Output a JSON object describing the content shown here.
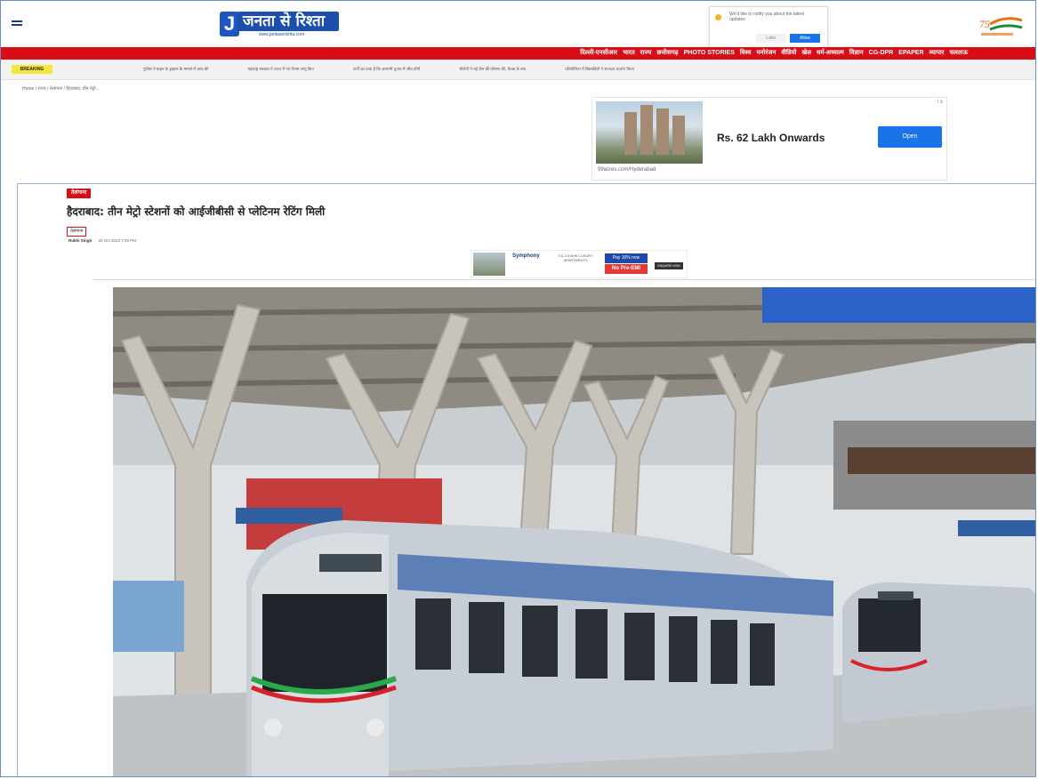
{
  "header": {
    "logo_letter": "J",
    "logo_name": "जनता से रिश्ता",
    "logo_url": "www.jantaserishta.com",
    "badge_text": "75"
  },
  "notification": {
    "message": "We'd like to notify you about the latest updates",
    "sub": "You can unsubscribe from notifications anytime",
    "later": "Later",
    "allow": "Allow"
  },
  "nav": {
    "items": [
      "दिल्ली-एनसीआर",
      "भारत",
      "राज्य",
      "छत्तीसगढ़",
      "PHOTO STORIES",
      "विश्व",
      "मनोरंजन",
      "वीडियो",
      "खेल",
      "धर्म-अध्यात्म",
      "विज्ञान",
      "CG-DPR",
      "EPAPER",
      "व्यापार",
      "चलताऊ"
    ]
  },
  "breaking": {
    "label": "BREAKING",
    "ticker": [
      "पुलिस ने वाहन के ड्राइवर के मामले में जांच की",
      "महाराष्ट्र सरकार ने राज्य में नए नियम लागू किए",
      "पार्टी का दावा है कि आगामी चुनाव में जीत होगी",
      "बीजेपी ने नई टीम की घोषणा की, बैठक के बाद",
      "प्रतियोगिता में खिलाड़ियों ने शानदार प्रदर्शन किया"
    ]
  },
  "breadcrumb": "Home / राज्य / तेलंगाना / हैदराबाद: तीन मेट्रो...",
  "ad": {
    "headline": "Rs. 62 Lakh Onwards",
    "cta": "Open",
    "domain": "99acres.com/Hyderabad",
    "info": "i x"
  },
  "article": {
    "category": "तेलंगाना",
    "title": "हैदराबाद: तीन मेट्रो स्टेशनों को आईजीबीसी से प्लेटिनम रेटिंग मिली",
    "category_tag": "तेलंगाना",
    "author": "Rukhi Singh",
    "date": "26 Oct 2023 7:49 PM"
  },
  "ad2": {
    "brand": "Symphony",
    "text": "3 & 3.5 BHK LUXURY APARTMENTS",
    "chip1": "Pay 10% now",
    "chip2": "No Pre-EMI",
    "cta": "ENQUIRE NOW"
  },
  "colors": {
    "brand_red": "#d80d16",
    "brand_blue": "#1c4fae",
    "breaking_yellow": "#f5e63a",
    "ad_button": "#1a73e8"
  }
}
